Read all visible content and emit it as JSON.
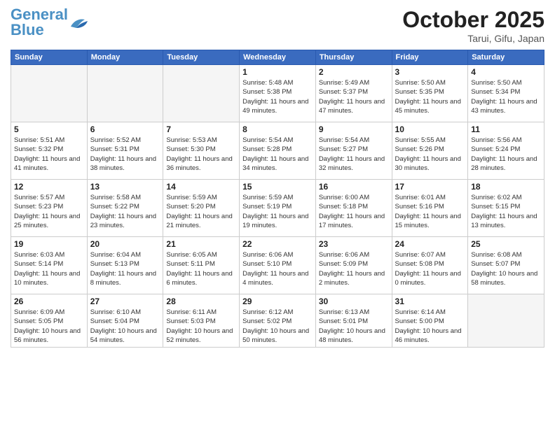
{
  "header": {
    "logo_general": "General",
    "logo_blue": "Blue",
    "month_title": "October 2025",
    "subtitle": "Tarui, Gifu, Japan"
  },
  "days_of_week": [
    "Sunday",
    "Monday",
    "Tuesday",
    "Wednesday",
    "Thursday",
    "Friday",
    "Saturday"
  ],
  "weeks": [
    [
      {
        "day": "",
        "info": ""
      },
      {
        "day": "",
        "info": ""
      },
      {
        "day": "",
        "info": ""
      },
      {
        "day": "1",
        "info": "Sunrise: 5:48 AM\nSunset: 5:38 PM\nDaylight: 11 hours\nand 49 minutes."
      },
      {
        "day": "2",
        "info": "Sunrise: 5:49 AM\nSunset: 5:37 PM\nDaylight: 11 hours\nand 47 minutes."
      },
      {
        "day": "3",
        "info": "Sunrise: 5:50 AM\nSunset: 5:35 PM\nDaylight: 11 hours\nand 45 minutes."
      },
      {
        "day": "4",
        "info": "Sunrise: 5:50 AM\nSunset: 5:34 PM\nDaylight: 11 hours\nand 43 minutes."
      }
    ],
    [
      {
        "day": "5",
        "info": "Sunrise: 5:51 AM\nSunset: 5:32 PM\nDaylight: 11 hours\nand 41 minutes."
      },
      {
        "day": "6",
        "info": "Sunrise: 5:52 AM\nSunset: 5:31 PM\nDaylight: 11 hours\nand 38 minutes."
      },
      {
        "day": "7",
        "info": "Sunrise: 5:53 AM\nSunset: 5:30 PM\nDaylight: 11 hours\nand 36 minutes."
      },
      {
        "day": "8",
        "info": "Sunrise: 5:54 AM\nSunset: 5:28 PM\nDaylight: 11 hours\nand 34 minutes."
      },
      {
        "day": "9",
        "info": "Sunrise: 5:54 AM\nSunset: 5:27 PM\nDaylight: 11 hours\nand 32 minutes."
      },
      {
        "day": "10",
        "info": "Sunrise: 5:55 AM\nSunset: 5:26 PM\nDaylight: 11 hours\nand 30 minutes."
      },
      {
        "day": "11",
        "info": "Sunrise: 5:56 AM\nSunset: 5:24 PM\nDaylight: 11 hours\nand 28 minutes."
      }
    ],
    [
      {
        "day": "12",
        "info": "Sunrise: 5:57 AM\nSunset: 5:23 PM\nDaylight: 11 hours\nand 25 minutes."
      },
      {
        "day": "13",
        "info": "Sunrise: 5:58 AM\nSunset: 5:22 PM\nDaylight: 11 hours\nand 23 minutes."
      },
      {
        "day": "14",
        "info": "Sunrise: 5:59 AM\nSunset: 5:20 PM\nDaylight: 11 hours\nand 21 minutes."
      },
      {
        "day": "15",
        "info": "Sunrise: 5:59 AM\nSunset: 5:19 PM\nDaylight: 11 hours\nand 19 minutes."
      },
      {
        "day": "16",
        "info": "Sunrise: 6:00 AM\nSunset: 5:18 PM\nDaylight: 11 hours\nand 17 minutes."
      },
      {
        "day": "17",
        "info": "Sunrise: 6:01 AM\nSunset: 5:16 PM\nDaylight: 11 hours\nand 15 minutes."
      },
      {
        "day": "18",
        "info": "Sunrise: 6:02 AM\nSunset: 5:15 PM\nDaylight: 11 hours\nand 13 minutes."
      }
    ],
    [
      {
        "day": "19",
        "info": "Sunrise: 6:03 AM\nSunset: 5:14 PM\nDaylight: 11 hours\nand 10 minutes."
      },
      {
        "day": "20",
        "info": "Sunrise: 6:04 AM\nSunset: 5:13 PM\nDaylight: 11 hours\nand 8 minutes."
      },
      {
        "day": "21",
        "info": "Sunrise: 6:05 AM\nSunset: 5:11 PM\nDaylight: 11 hours\nand 6 minutes."
      },
      {
        "day": "22",
        "info": "Sunrise: 6:06 AM\nSunset: 5:10 PM\nDaylight: 11 hours\nand 4 minutes."
      },
      {
        "day": "23",
        "info": "Sunrise: 6:06 AM\nSunset: 5:09 PM\nDaylight: 11 hours\nand 2 minutes."
      },
      {
        "day": "24",
        "info": "Sunrise: 6:07 AM\nSunset: 5:08 PM\nDaylight: 11 hours\nand 0 minutes."
      },
      {
        "day": "25",
        "info": "Sunrise: 6:08 AM\nSunset: 5:07 PM\nDaylight: 10 hours\nand 58 minutes."
      }
    ],
    [
      {
        "day": "26",
        "info": "Sunrise: 6:09 AM\nSunset: 5:05 PM\nDaylight: 10 hours\nand 56 minutes."
      },
      {
        "day": "27",
        "info": "Sunrise: 6:10 AM\nSunset: 5:04 PM\nDaylight: 10 hours\nand 54 minutes."
      },
      {
        "day": "28",
        "info": "Sunrise: 6:11 AM\nSunset: 5:03 PM\nDaylight: 10 hours\nand 52 minutes."
      },
      {
        "day": "29",
        "info": "Sunrise: 6:12 AM\nSunset: 5:02 PM\nDaylight: 10 hours\nand 50 minutes."
      },
      {
        "day": "30",
        "info": "Sunrise: 6:13 AM\nSunset: 5:01 PM\nDaylight: 10 hours\nand 48 minutes."
      },
      {
        "day": "31",
        "info": "Sunrise: 6:14 AM\nSunset: 5:00 PM\nDaylight: 10 hours\nand 46 minutes."
      },
      {
        "day": "",
        "info": ""
      }
    ]
  ]
}
